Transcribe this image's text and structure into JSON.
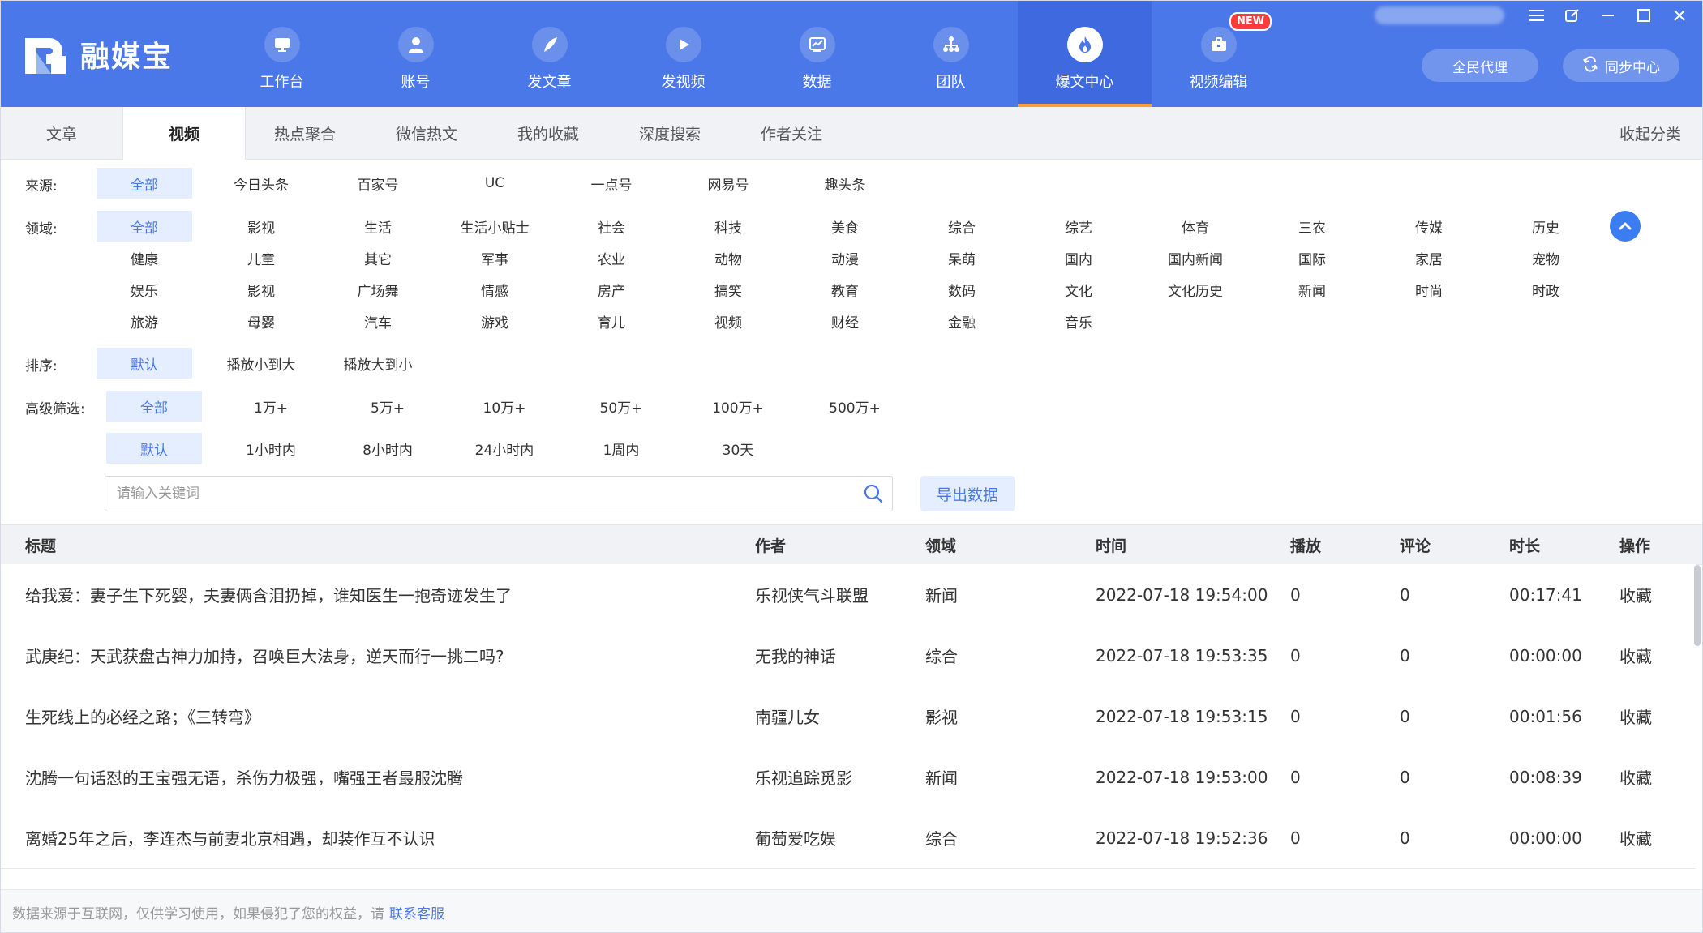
{
  "app": {
    "name": "融媒宝"
  },
  "nav": [
    {
      "label": "工作台",
      "icon": "monitor-icon"
    },
    {
      "label": "账号",
      "icon": "user-icon"
    },
    {
      "label": "发文章",
      "icon": "feather-icon"
    },
    {
      "label": "发视频",
      "icon": "play-icon"
    },
    {
      "label": "数据",
      "icon": "chart-icon"
    },
    {
      "label": "团队",
      "icon": "org-icon"
    },
    {
      "label": "爆文中心",
      "icon": "fire-icon",
      "active": true
    },
    {
      "label": "视频编辑",
      "icon": "briefcase-icon",
      "badge": "NEW"
    }
  ],
  "header_buttons": {
    "agent": "全民代理",
    "sync": "同步中心"
  },
  "tabs": [
    "文章",
    "视频",
    "热点聚合",
    "微信热文",
    "我的收藏",
    "深度搜索",
    "作者关注"
  ],
  "active_tab": "视频",
  "collapse_label": "收起分类",
  "filters": {
    "source": {
      "label": "来源:",
      "options": [
        "全部",
        "今日头条",
        "百家号",
        "UC",
        "一点号",
        "网易号",
        "趣头条"
      ]
    },
    "domain": {
      "label": "领域:",
      "rows": [
        [
          "全部",
          "影视",
          "生活",
          "生活小贴士",
          "社会",
          "科技",
          "美食",
          "综合",
          "综艺",
          "体育",
          "三农",
          "传媒",
          "历史"
        ],
        [
          "健康",
          "儿童",
          "其它",
          "军事",
          "农业",
          "动物",
          "动漫",
          "呆萌",
          "国内",
          "国内新闻",
          "国际",
          "家居",
          "宠物"
        ],
        [
          "娱乐",
          "影视",
          "广场舞",
          "情感",
          "房产",
          "搞笑",
          "教育",
          "数码",
          "文化",
          "文化历史",
          "新闻",
          "时尚",
          "时政"
        ],
        [
          "旅游",
          "母婴",
          "汽车",
          "游戏",
          "育儿",
          "视频",
          "财经",
          "金融",
          "音乐"
        ]
      ]
    },
    "sort": {
      "label": "排序:",
      "options": [
        "默认",
        "播放小到大",
        "播放大到小"
      ]
    },
    "advanced": {
      "label": "高级筛选:",
      "plays": [
        "全部",
        "1万+",
        "5万+",
        "10万+",
        "50万+",
        "100万+",
        "500万+"
      ],
      "times": [
        "默认",
        "1小时内",
        "8小时内",
        "24小时内",
        "1周内",
        "30天"
      ]
    }
  },
  "search": {
    "placeholder": "请输入关键词",
    "value": ""
  },
  "export_label": "导出数据",
  "table": {
    "headers": [
      "标题",
      "作者",
      "领域",
      "时间",
      "播放",
      "评论",
      "时长",
      "操作"
    ],
    "rows": [
      {
        "title": "给我爱：妻子生下死婴，夫妻俩含泪扔掉，谁知医生一抱奇迹发生了",
        "author": "乐视侠气斗联盟",
        "domain": "新闻",
        "time": "2022-07-18 19:54:00",
        "plays": "0",
        "comments": "0",
        "duration": "00:17:41",
        "action": "收藏"
      },
      {
        "title": "武庚纪：天武获盘古神力加持，召唤巨大法身，逆天而行一挑二吗?",
        "author": "无我的神话",
        "domain": "综合",
        "time": "2022-07-18 19:53:35",
        "plays": "0",
        "comments": "0",
        "duration": "00:00:00",
        "action": "收藏"
      },
      {
        "title": "生死线上的必经之路；《三转弯》",
        "author": "南疆儿女",
        "domain": "影视",
        "time": "2022-07-18 19:53:15",
        "plays": "0",
        "comments": "0",
        "duration": "00:01:56",
        "action": "收藏"
      },
      {
        "title": "沈腾一句话怼的王宝强无语，杀伤力极强，嘴强王者最服沈腾",
        "author": "乐视追踪觅影",
        "domain": "新闻",
        "time": "2022-07-18 19:53:00",
        "plays": "0",
        "comments": "0",
        "duration": "00:08:39",
        "action": "收藏"
      },
      {
        "title": "离婚25年之后，李连杰与前妻北京相遇，却装作互不认识",
        "author": "葡萄爱吃娱",
        "domain": "综合",
        "time": "2022-07-18 19:52:36",
        "plays": "0",
        "comments": "0",
        "duration": "00:00:00",
        "action": "收藏"
      }
    ]
  },
  "footer": {
    "text": "数据来源于互联网，仅供学习使用，如果侵犯了您的权益，请",
    "link": "联系客服"
  },
  "colors": {
    "header": "#4a78e8",
    "accent": "#4a78e8",
    "chip_active_bg": "#e4eefe",
    "active_underline": "#ff9c3a",
    "badge": "#ff3b3b"
  }
}
